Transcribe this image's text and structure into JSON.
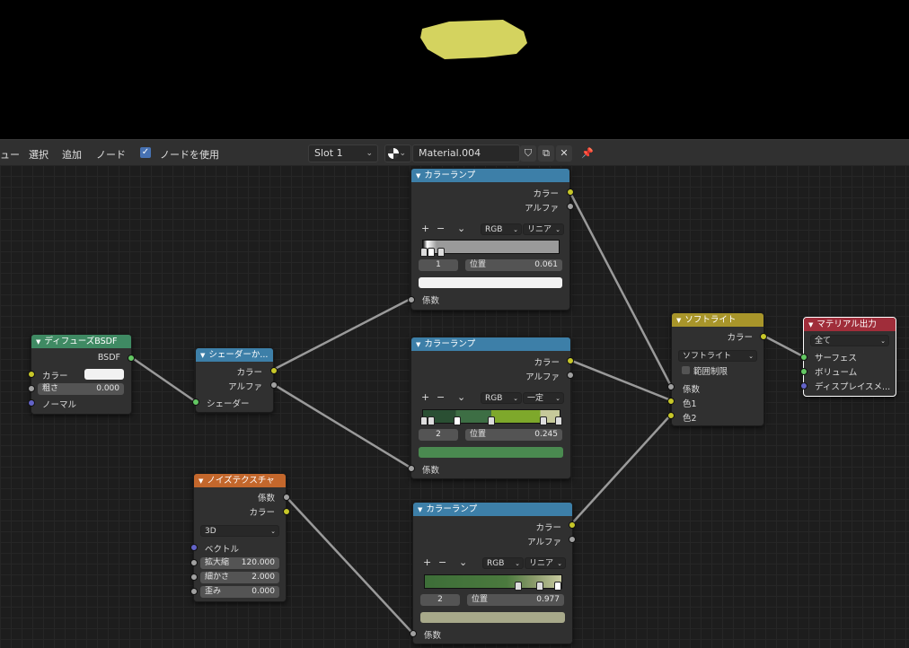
{
  "viewport": {
    "blob_color": "#d4d35f"
  },
  "header": {
    "menu_view": "ュー",
    "menu_select": "選択",
    "menu_add": "追加",
    "menu_node": "ノード",
    "use_nodes_label": "ノードを使用",
    "slot": "Slot 1",
    "material_name": "Material.004"
  },
  "nodes": {
    "diffuse": {
      "title": "ディフューズBSDF",
      "out_bsdf": "BSDF",
      "color": "カラー",
      "roughness": "粗さ",
      "roughness_value": "0.000",
      "normal": "ノーマル"
    },
    "shader_to_rgb": {
      "title": "シェーダーか...",
      "out_color": "カラー",
      "out_alpha": "アルファ",
      "in_shader": "シェーダー"
    },
    "noise": {
      "title": "ノイズテクスチャ",
      "out_fac": "係数",
      "out_color": "カラー",
      "dimensions": "3D",
      "vector": "ベクトル",
      "scale": "拡大縮",
      "scale_value": "120.000",
      "detail": "細かさ",
      "detail_value": "2.000",
      "distortion": "歪み",
      "distortion_value": "0.000"
    },
    "ramp1": {
      "title": "カラーランプ",
      "out_color": "カラー",
      "out_alpha": "アルファ",
      "mode": "RGB",
      "interp": "リニア",
      "index": "1",
      "pos_label": "位置",
      "pos_value": "0.061",
      "fac": "係数",
      "swatch": "#f2f2f2"
    },
    "ramp2": {
      "title": "カラーランプ",
      "out_color": "カラー",
      "out_alpha": "アルファ",
      "mode": "RGB",
      "interp": "一定",
      "index": "2",
      "pos_label": "位置",
      "pos_value": "0.245",
      "fac": "係数",
      "swatch": "#4a8a50"
    },
    "ramp3": {
      "title": "カラーランプ",
      "out_color": "カラー",
      "out_alpha": "アルファ",
      "mode": "RGB",
      "interp": "リニア",
      "index": "2",
      "pos_label": "位置",
      "pos_value": "0.977",
      "fac": "係数",
      "swatch": "#a8a98a"
    },
    "softlight": {
      "title": "ソフトライト",
      "out_color": "カラー",
      "blend": "ソフトライト",
      "clamp": "範囲制限",
      "fac": "係数",
      "color1": "色1",
      "color2": "色2"
    },
    "output": {
      "title": "マテリアル出力",
      "target": "全て",
      "surface": "サーフェス",
      "volume": "ボリューム",
      "displacement": "ディスプレイスメ..."
    }
  },
  "colors": {
    "shader_header": "#3f8a63",
    "converter_header": "#3d7fa8",
    "texture_header": "#c3672c",
    "color_header": "#a8952a",
    "output_header": "#a02d3a",
    "checkbox": "#4772b3"
  }
}
